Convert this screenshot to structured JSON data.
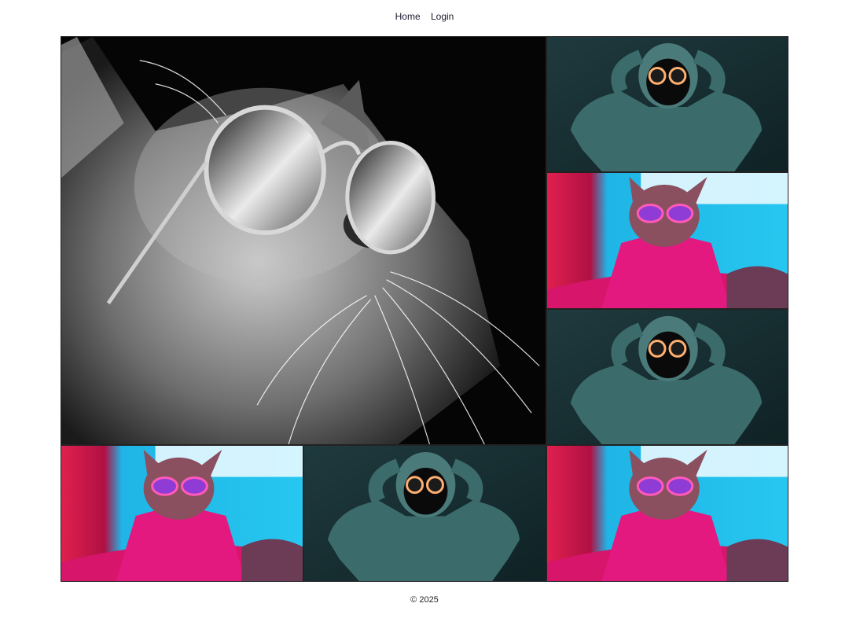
{
  "nav": {
    "items": [
      {
        "label": "Home"
      },
      {
        "label": "Login"
      }
    ]
  },
  "gallery": {
    "images": [
      {
        "subject": "black-and-white cat wearing round sunglasses"
      },
      {
        "subject": "person in teal hoodie with glowing round goggles"
      },
      {
        "subject": "cat in pink jacket with purple sunglasses, neon blue and red light"
      },
      {
        "subject": "person in teal hoodie with glowing round goggles"
      },
      {
        "subject": "cat in pink jacket with purple sunglasses, neon blue and red light"
      },
      {
        "subject": "person in teal hoodie with glowing round goggles"
      },
      {
        "subject": "cat in pink jacket with purple sunglasses, neon blue and red light"
      }
    ]
  },
  "footer": {
    "text": "© 2025"
  }
}
